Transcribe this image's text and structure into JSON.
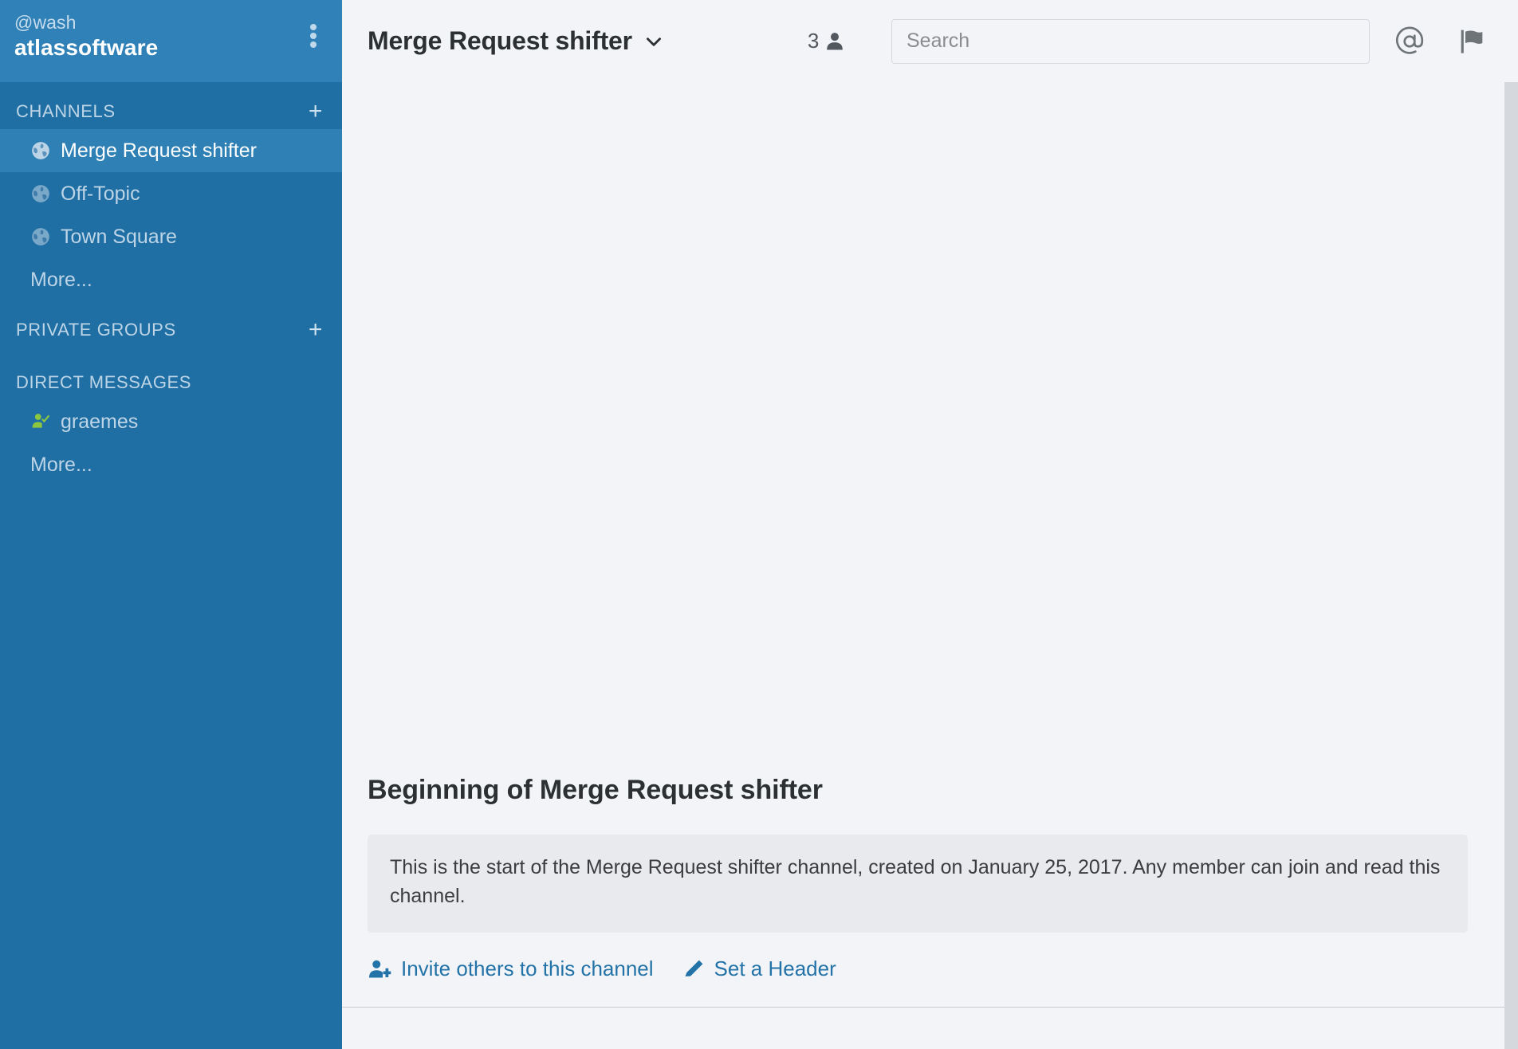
{
  "sidebar": {
    "team": {
      "user_handle": "@wash",
      "team_name": "atlassoftware",
      "menu_icon": "dots-vertical-icon"
    },
    "sections": [
      {
        "id": "channels",
        "title": "CHANNELS",
        "add_label": "+",
        "items": [
          {
            "label": "Merge Request shifter",
            "icon": "globe-icon",
            "active": true
          },
          {
            "label": "Off-Topic",
            "icon": "globe-icon",
            "active": false
          },
          {
            "label": "Town Square",
            "icon": "globe-icon",
            "active": false
          }
        ],
        "more_label": "More..."
      },
      {
        "id": "private-groups",
        "title": "PRIVATE GROUPS",
        "add_label": "+",
        "items": [],
        "more_label": ""
      },
      {
        "id": "direct-messages",
        "title": "DIRECT MESSAGES",
        "add_label": "",
        "items": [
          {
            "label": "graemes",
            "icon": "user-online-icon",
            "active": false
          }
        ],
        "more_label": "More..."
      }
    ]
  },
  "header": {
    "channel_name": "Merge Request shifter",
    "dropdown_icon": "chevron-down-icon",
    "member_count": "3",
    "member_icon": "user-icon",
    "search_placeholder": "Search",
    "search_value": "",
    "mention_icon": "at-mention-icon",
    "flag_icon": "flag-icon"
  },
  "main": {
    "intro_title": "Beginning of Merge Request shifter",
    "intro_description": "This is the start of the Merge Request shifter channel, created on January 25, 2017. Any member can join and read this channel.",
    "actions": [
      {
        "label": "Invite others to this channel",
        "icon": "user-add-icon"
      },
      {
        "label": "Set a Header",
        "icon": "pencil-icon"
      }
    ]
  },
  "colors": {
    "sidebar_bg": "#1f6ea4",
    "sidebar_header_bg": "#2f81b7",
    "sidebar_active_bg": "#2e80b5",
    "sidebar_text": "#bdd5e6",
    "main_bg": "#f2f4f8",
    "link_blue": "#2373a8",
    "online_green": "#7cb342",
    "text_dark": "#2d3033",
    "desc_bg": "#e8eaed"
  }
}
